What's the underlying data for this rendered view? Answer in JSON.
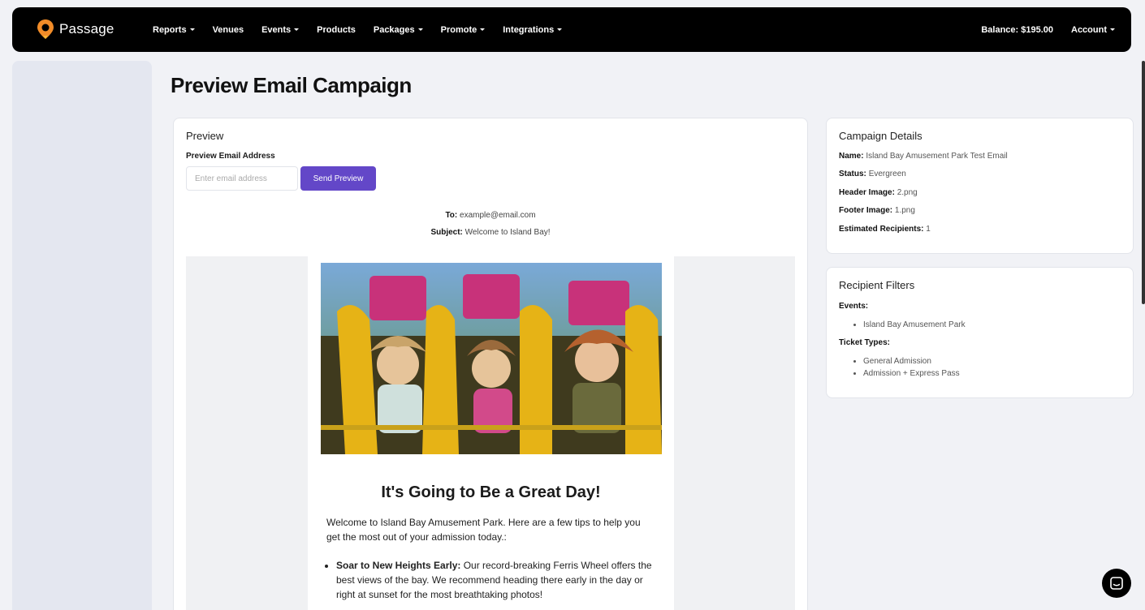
{
  "nav": {
    "brand": "Passage",
    "items": [
      {
        "label": "Reports",
        "dropdown": true
      },
      {
        "label": "Venues",
        "dropdown": false
      },
      {
        "label": "Events",
        "dropdown": true
      },
      {
        "label": "Products",
        "dropdown": false
      },
      {
        "label": "Packages",
        "dropdown": true
      },
      {
        "label": "Promote",
        "dropdown": true
      },
      {
        "label": "Integrations",
        "dropdown": true
      }
    ],
    "balance": "Balance: $195.00",
    "account": "Account"
  },
  "page": {
    "title": "Preview Email Campaign"
  },
  "preview": {
    "heading": "Preview",
    "field_label": "Preview Email Address",
    "input_placeholder": "Enter email address",
    "send_button": "Send Preview",
    "to_label": "To:",
    "to_value": "example@email.com",
    "subject_label": "Subject:",
    "subject_value": "Welcome to Island Bay!",
    "email_title": "It's Going to Be a Great Day!",
    "email_intro": "Welcome to Island Bay Amusement Park. Here are a few tips to help you get the most out of your admission today.:",
    "tips": [
      {
        "bold": "Soar to New Heights Early:",
        "text": " Our record-breaking Ferris Wheel offers the best views of the bay. We recommend heading there early in the day or right at sunset for the most breathtaking photos!"
      }
    ]
  },
  "details": {
    "heading": "Campaign Details",
    "rows": [
      {
        "label": "Name:",
        "value": "Island Bay Amusement Park Test Email"
      },
      {
        "label": "Status:",
        "value": "Evergreen"
      },
      {
        "label": "Header Image:",
        "value": "2.png"
      },
      {
        "label": "Footer Image:",
        "value": "1.png"
      },
      {
        "label": "Estimated Recipients:",
        "value": "1"
      }
    ]
  },
  "filters": {
    "heading": "Recipient Filters",
    "events_label": "Events:",
    "events": [
      "Island Bay Amusement Park"
    ],
    "tickets_label": "Ticket Types:",
    "tickets": [
      "General Admission",
      "Admission + Express Pass"
    ]
  },
  "colors": {
    "accent": "#6347c8",
    "nav_bg": "#000000",
    "logo_orange": "#f28c28"
  }
}
